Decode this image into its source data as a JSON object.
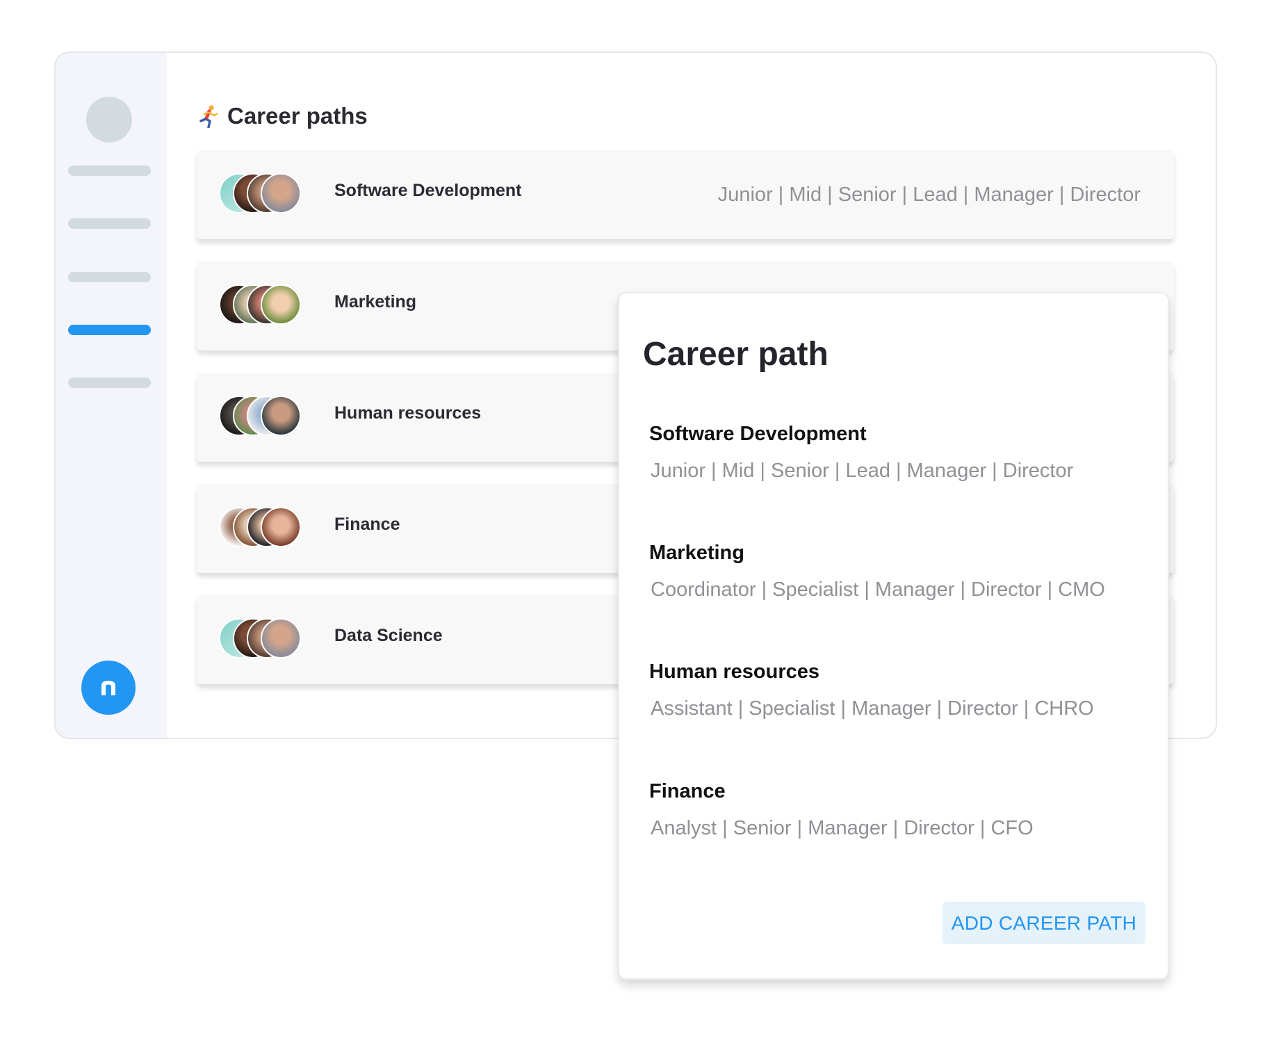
{
  "page": {
    "title": "Career paths",
    "title_icon": "running-person-icon"
  },
  "sidebar": {
    "logo_letter": "n",
    "accent": "#2196f3",
    "inactive_color": "#d3dbe1"
  },
  "paths": [
    {
      "name": "Software Development",
      "levels": "Junior | Mid | Senior | Lead | Manager | Director"
    },
    {
      "name": "Marketing",
      "levels": ""
    },
    {
      "name": "Human resources",
      "levels": ""
    },
    {
      "name": "Finance",
      "levels": ""
    },
    {
      "name": "Data Science",
      "levels": ""
    }
  ],
  "panel": {
    "title": "Career path",
    "sections": [
      {
        "name": "Software Development",
        "levels": "Junior | Mid | Senior | Lead | Manager | Director"
      },
      {
        "name": "Marketing",
        "levels": "Coordinator | Specialist | Manager | Director | CMO"
      },
      {
        "name": "Human resources",
        "levels": "Assistant | Specialist | Manager | Director | CHRO"
      },
      {
        "name": "Finance",
        "levels": "Analyst | Senior | Manager | Director | CFO"
      }
    ],
    "add_button": "ADD CAREER PATH"
  }
}
